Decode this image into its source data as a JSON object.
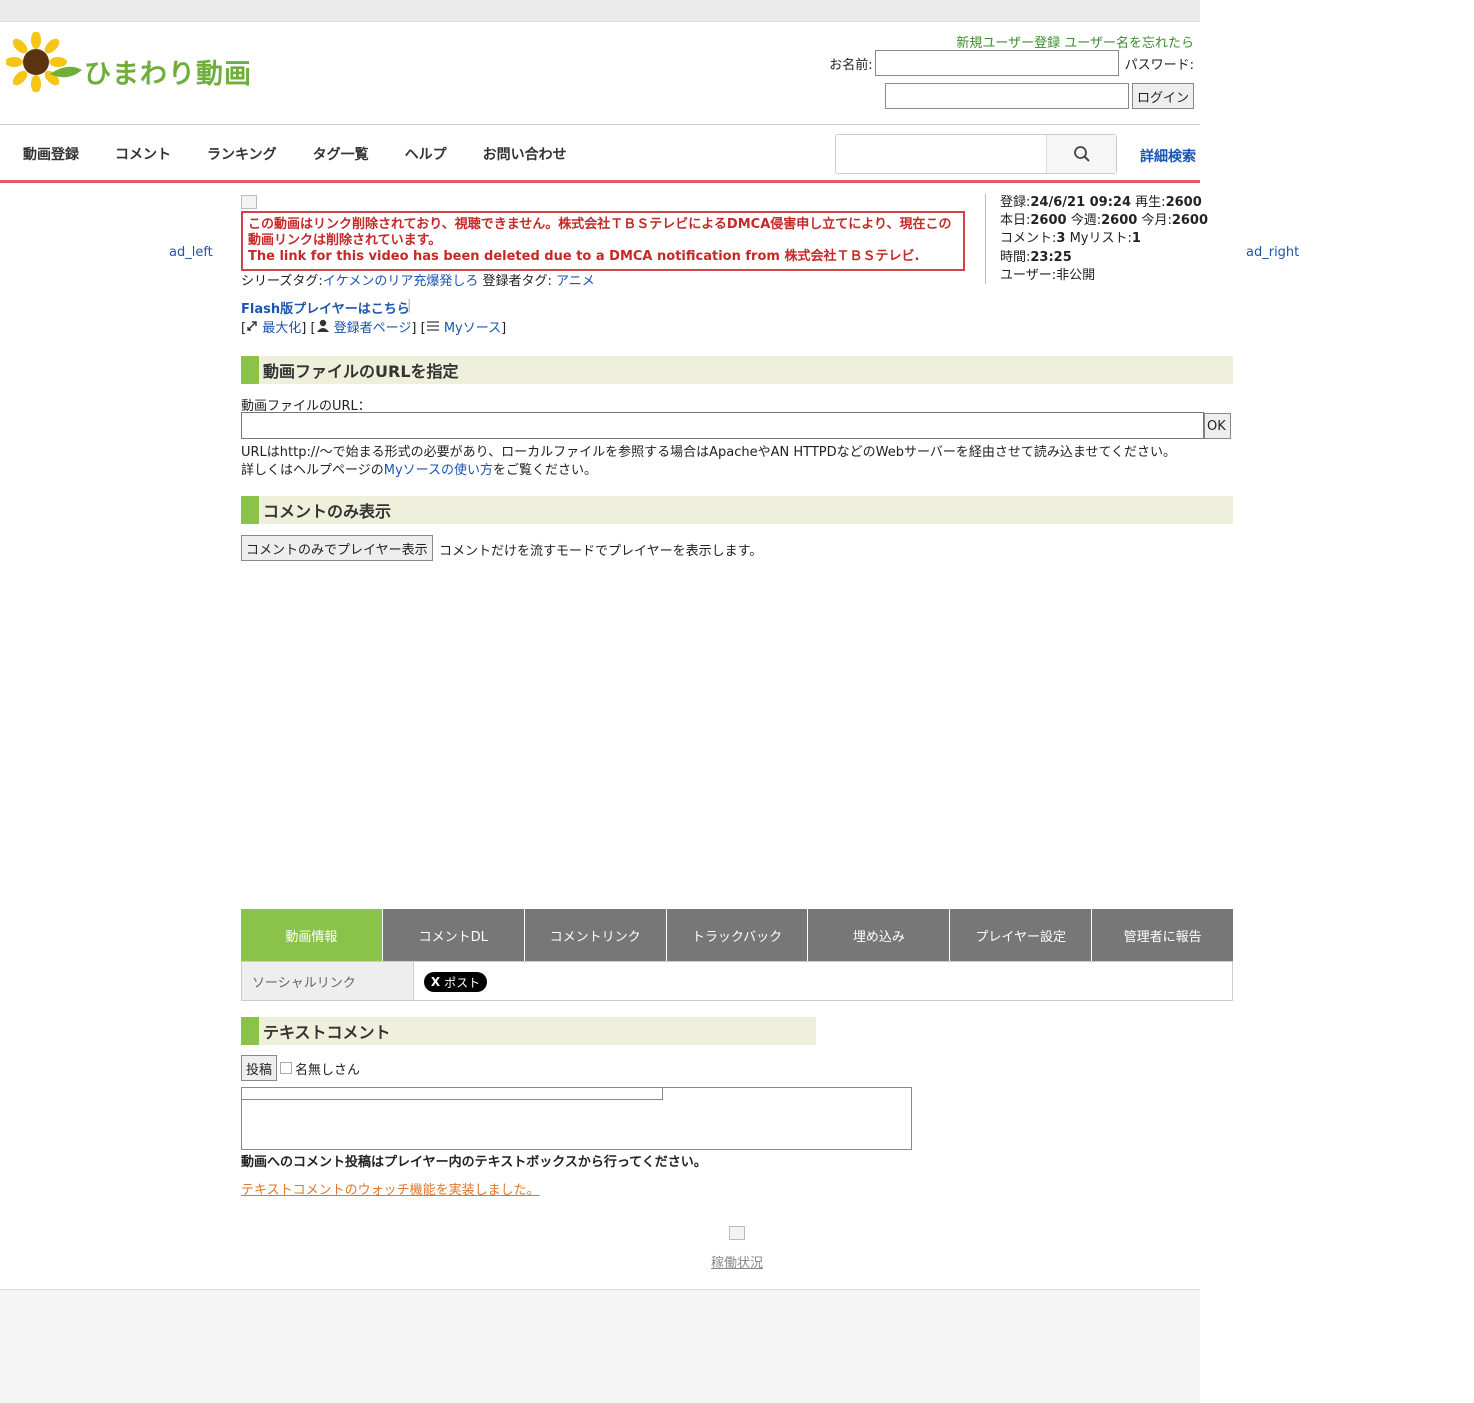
{
  "header": {
    "logo_text": "ひまわり動画",
    "register_link": "新規ユーザー登録",
    "forgot_link": "ユーザー名を忘れたら",
    "name_label": "お名前:",
    "password_label": "パスワード:",
    "login_button": "ログイン"
  },
  "nav": {
    "items": [
      "動画登録",
      "コメント",
      "ランキング",
      "タグ一覧",
      "ヘルプ",
      "お問い合わせ"
    ],
    "advanced_search": "詳細検索"
  },
  "ads": {
    "left": "ad_left",
    "right": "ad_right"
  },
  "video": {
    "dmca_line1": "この動画はリンク削除されており、視聴できません。株式会社ＴＢＳテレビによるDMCA侵害申し立てにより、現在この動画リンクは削除されています。",
    "dmca_line2": "The link for this video has been deleted due to a DMCA notification from 株式会社ＴＢＳテレビ.",
    "series_tag_label": "シリーズタグ:",
    "series_tag": "イケメンのリア充爆発しろ",
    "user_tag_label": "登録者タグ:",
    "user_tag": "アニメ",
    "flash_link": "Flash版プレイヤーはこちら",
    "maximize": "最大化",
    "uploader_page": "登録者ページ",
    "my_source": "Myソース"
  },
  "stats": {
    "registered_label": "登録:",
    "registered": "24/6/21 09:24",
    "plays_label": "再生:",
    "plays": "2600",
    "today_label": "本日:",
    "today": "2600",
    "week_label": "今週:",
    "week": "2600",
    "month_label": "今月:",
    "month": "2600",
    "comments_label": "コメント:",
    "comments": "3",
    "mylist_label": "Myリスト:",
    "mylist": "1",
    "duration_label": "時間:",
    "duration": "23:25",
    "user_label": "ユーザー:",
    "user": "非公開"
  },
  "url_section": {
    "title": "動画ファイルのURLを指定",
    "field_label": "動画ファイルのURL：",
    "ok_button": "OK",
    "help_line1": "URLはhttp://〜で始まる形式の必要があり、ローカルファイルを参照する場合はApacheやAN HTTPDなどのWebサーバーを経由させて読み込ませてください。",
    "help_line2_pre": "詳しくはヘルプページの",
    "help_line2_link": "Myソースの使い方",
    "help_line2_post": "をご覧ください。"
  },
  "comment_only": {
    "title": "コメントのみ表示",
    "button": "コメントのみでプレイヤー表示",
    "desc": "コメントだけを流すモードでプレイヤーを表示します。"
  },
  "tabs": [
    "動画情報",
    "コメントDL",
    "コメントリンク",
    "トラックバック",
    "埋め込み",
    "プレイヤー設定",
    "管理者に報告"
  ],
  "social": {
    "label": "ソーシャルリンク",
    "x_button": "ポスト"
  },
  "text_comment": {
    "title": "テキストコメント",
    "post_button": "投稿",
    "anon_label": "名無しさん",
    "note": "動画へのコメント投稿はプレイヤー内のテキストボックスから行ってください。",
    "watch_link": "テキストコメントのウォッチ機能を実装しました。"
  },
  "status_link": "稼働状況"
}
